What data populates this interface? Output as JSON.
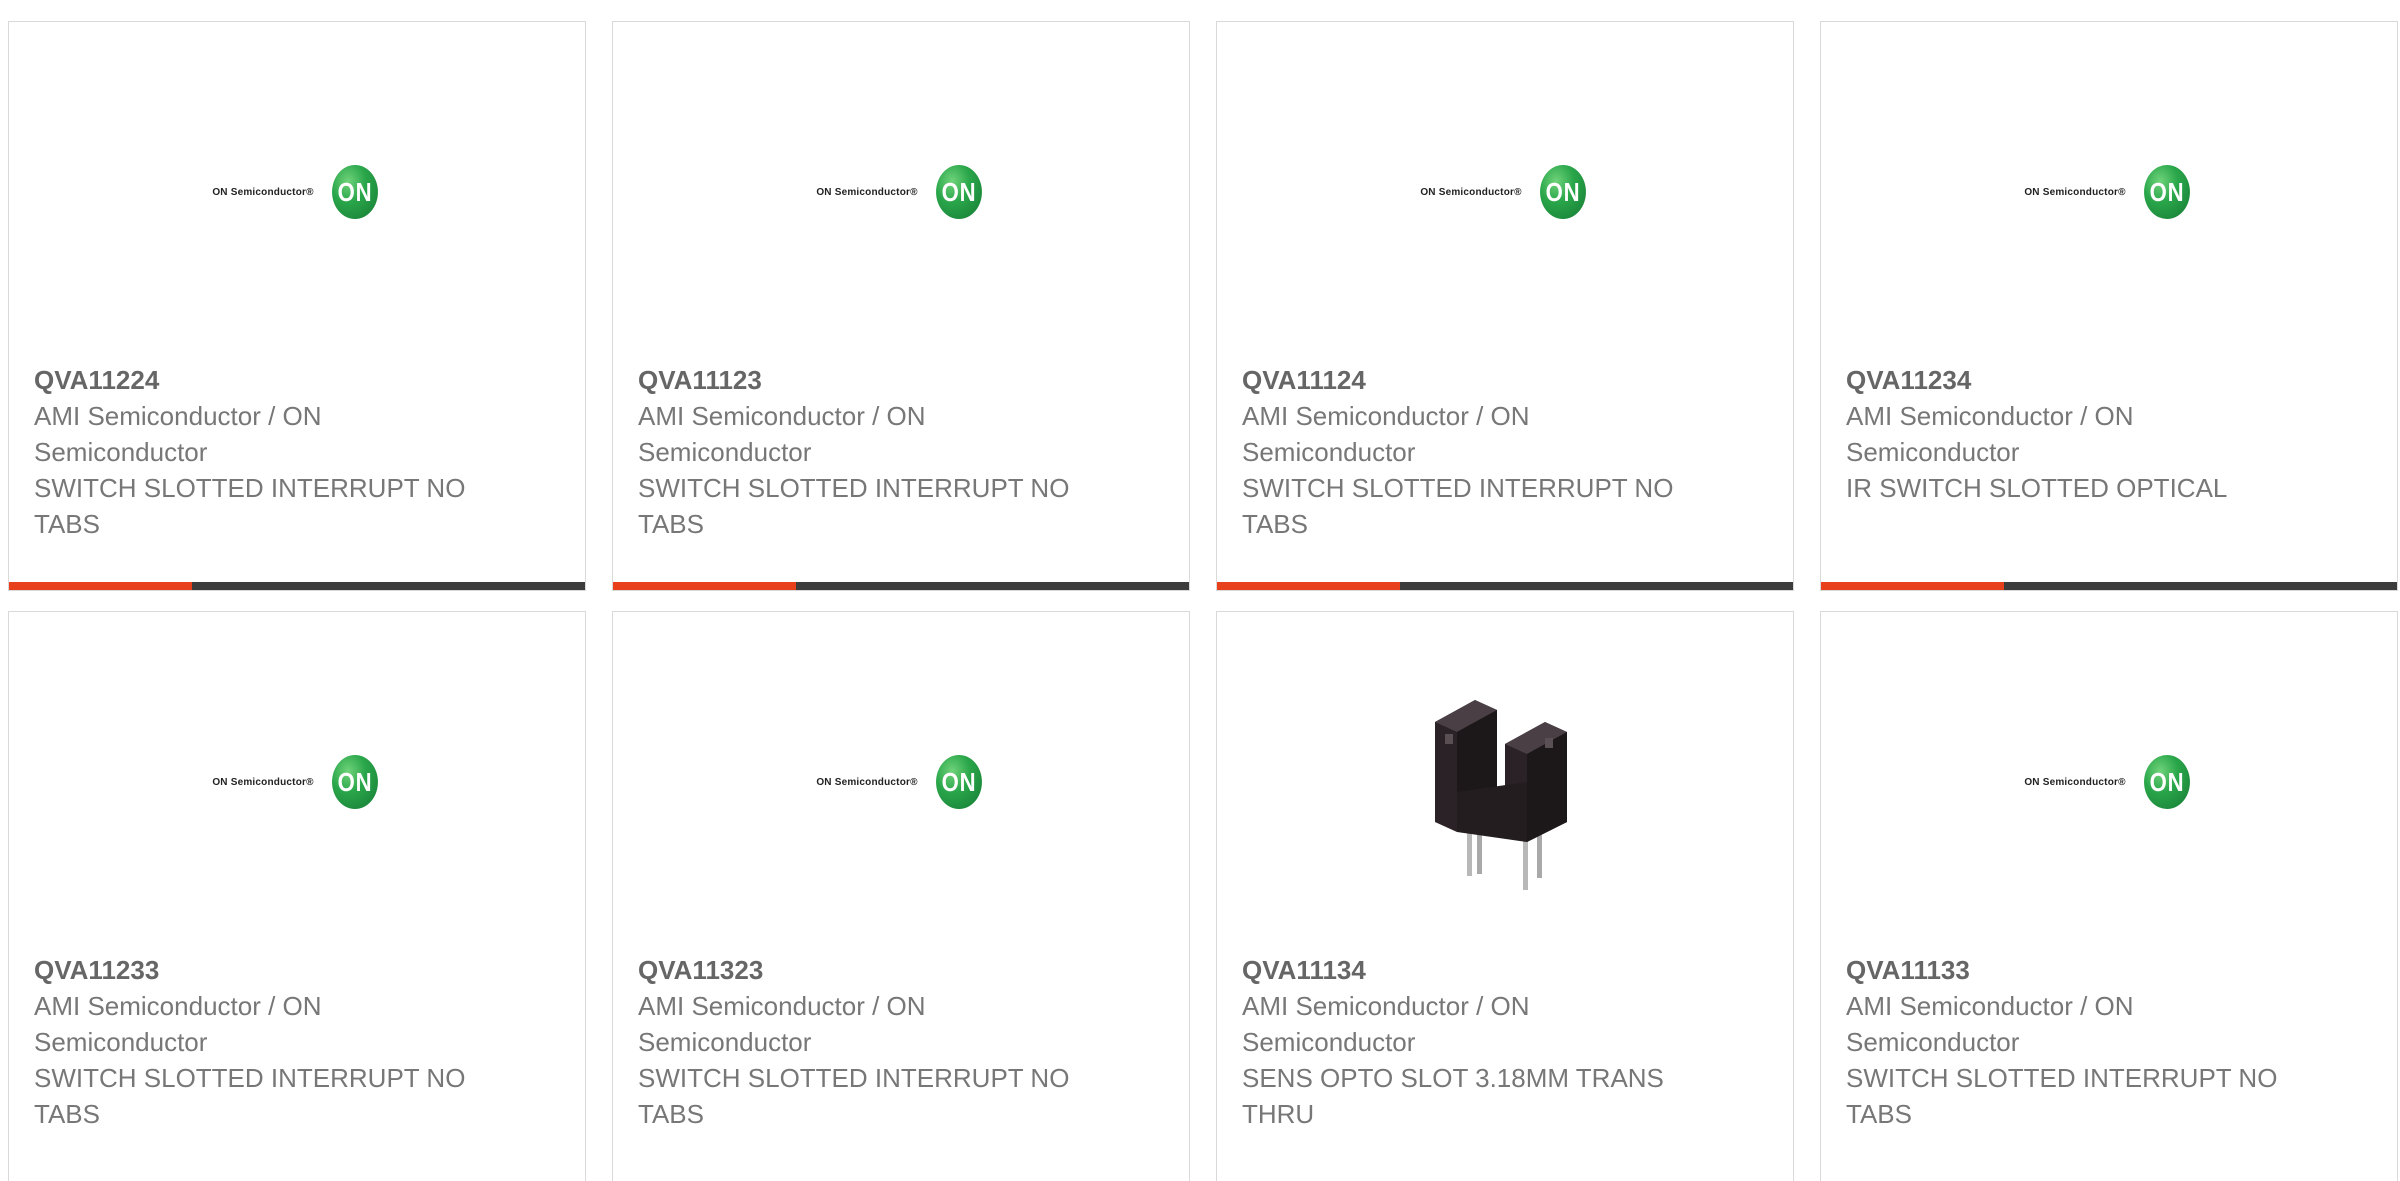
{
  "logo": {
    "brand_text": "ON Semiconductor®",
    "badge_text": "ON"
  },
  "products": [
    {
      "part_number": "QVA11224",
      "manufacturer": "AMI Semiconductor / ON Semiconductor",
      "description": "SWITCH SLOTTED INTERRUPT NO TABS",
      "image": "on-semiconductor-logo"
    },
    {
      "part_number": "QVA11123",
      "manufacturer": "AMI Semiconductor / ON Semiconductor",
      "description": "SWITCH SLOTTED INTERRUPT NO TABS",
      "image": "on-semiconductor-logo"
    },
    {
      "part_number": "QVA11124",
      "manufacturer": "AMI Semiconductor / ON Semiconductor",
      "description": "SWITCH SLOTTED INTERRUPT NO TABS",
      "image": "on-semiconductor-logo"
    },
    {
      "part_number": "QVA11234",
      "manufacturer": "AMI Semiconductor / ON Semiconductor",
      "description": "IR SWITCH SLOTTED OPTICAL",
      "image": "on-semiconductor-logo"
    },
    {
      "part_number": "QVA11233",
      "manufacturer": "AMI Semiconductor / ON Semiconductor",
      "description": "SWITCH SLOTTED INTERRUPT NO TABS",
      "image": "on-semiconductor-logo"
    },
    {
      "part_number": "QVA11323",
      "manufacturer": "AMI Semiconductor / ON Semiconductor",
      "description": "SWITCH SLOTTED INTERRUPT NO TABS",
      "image": "on-semiconductor-logo"
    },
    {
      "part_number": "QVA11134",
      "manufacturer": "AMI Semiconductor / ON Semiconductor",
      "description": "SENS OPTO SLOT 3.18MM TRANS THRU",
      "image": "slotted-optical-switch-photo"
    },
    {
      "part_number": "QVA11133",
      "manufacturer": "AMI Semiconductor / ON Semiconductor",
      "description": "SWITCH SLOTTED INTERRUPT NO TABS",
      "image": "on-semiconductor-logo"
    }
  ],
  "colors": {
    "accent_bar": "#e8401a",
    "dark_bar": "#3c3c3c",
    "part_number_text": "#666666",
    "body_text": "#777777",
    "card_border": "#d9d9d9"
  }
}
